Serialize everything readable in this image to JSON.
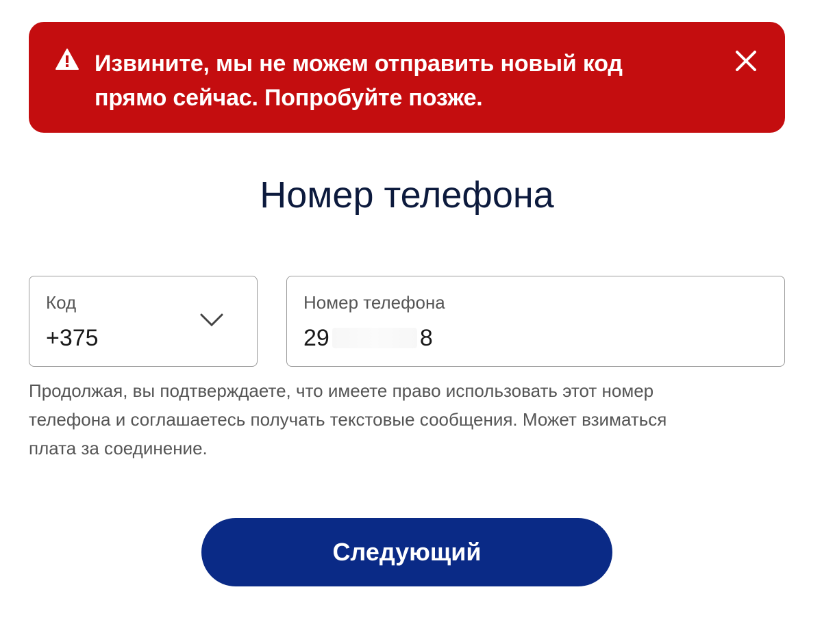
{
  "alert": {
    "icon": "warning-triangle-icon",
    "line1": "Извините, мы не можем отправить новый код",
    "line2": "прямо сейчас. Попробуйте позже.",
    "close_icon": "close-icon",
    "background_color": "#c40d0f"
  },
  "page": {
    "title": "Номер телефона"
  },
  "country_code": {
    "label": "Код",
    "value": "+375",
    "dropdown_icon": "chevron-down-icon"
  },
  "phone": {
    "label": "Номер телефона",
    "value_prefix": "29",
    "value_suffix": "8"
  },
  "disclaimer": {
    "line1": "Продолжая, вы подтверждаете, что имеете право использовать этот номер",
    "line2": "телефона и соглашаетесь получать текстовые сообщения. Может взиматься",
    "line3": "плата за соединение."
  },
  "actions": {
    "next_label": "Следующий",
    "button_color": "#0a2a86"
  }
}
